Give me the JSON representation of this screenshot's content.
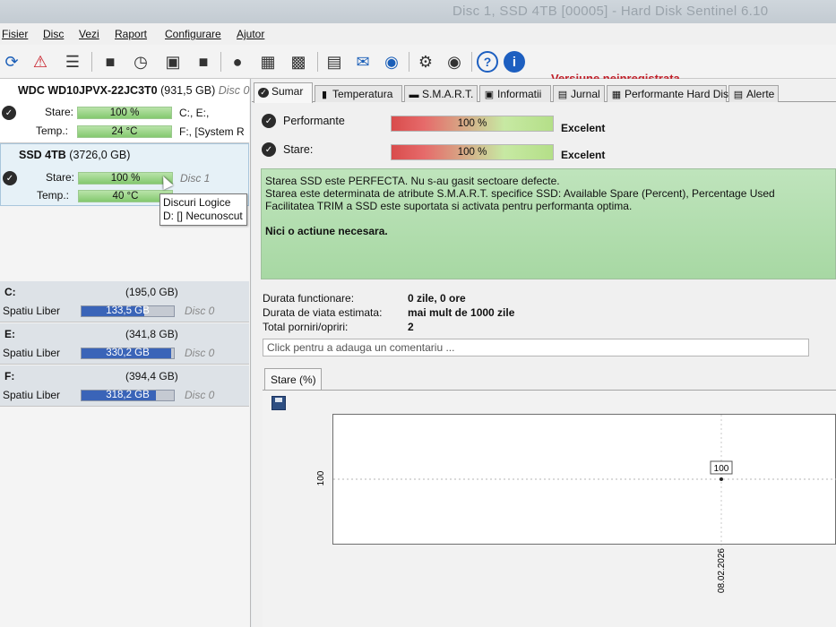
{
  "window": {
    "title": "Disc 1, SSD 4TB [00005] - Hard Disk Sentinel 6.10"
  },
  "menu": {
    "items": [
      "Fisier",
      "Disc",
      "Vezi",
      "Raport",
      "Configurare",
      "Ajutor"
    ]
  },
  "toolbar": {
    "icons": [
      "refresh-icon",
      "alert-icon",
      "disk-list-icon",
      "drive-icon",
      "drive-clock-icon",
      "drive-check-icon",
      "drive-icon",
      "drive-icon",
      "drive-stack-icon",
      "drive-stack-icon",
      "report-icon",
      "mail-icon",
      "network-icon",
      "gear-icon",
      "disk-gear-icon",
      "help-icon",
      "info-icon"
    ],
    "unregistered": "Versiune neinregistrata"
  },
  "disks": [
    {
      "name": "WDC WD10JPVX-22JC3T0",
      "size": "(931,5 GB)",
      "disc": "Disc 0",
      "stare_label": "Stare:",
      "stare": "100 %",
      "temp_label": "Temp.:",
      "temp": "24 °C",
      "letters": "C:, E:,",
      "system": "F:, [System R"
    },
    {
      "name": "SSD 4TB",
      "size": "(3726,0 GB)",
      "disc": "Disc 1",
      "stare_label": "Stare:",
      "stare": "100 %",
      "temp_label": "Temp.:",
      "temp": "40 °C"
    }
  ],
  "tooltip": {
    "line1": "Discuri Logice",
    "line2": "D: [] Necunoscut"
  },
  "partitions": [
    {
      "letter": "C:",
      "size": "(195,0 GB)",
      "free_label": "Spatiu Liber",
      "free": "133,5 GB",
      "disc": "Disc 0",
      "fill": 0.68
    },
    {
      "letter": "E:",
      "size": "(341,8 GB)",
      "free_label": "Spatiu Liber",
      "free": "330,2 GB",
      "disc": "Disc 0",
      "fill": 0.97
    },
    {
      "letter": "F:",
      "size": "(394,4 GB)",
      "free_label": "Spatiu Liber",
      "free": "318,2 GB",
      "disc": "Disc 0",
      "fill": 0.81
    }
  ],
  "tabs": [
    "Sumar",
    "Temperatura",
    "S.M.A.R.T.",
    "Informatii",
    "Jurnal",
    "Performante Hard Disk",
    "Alerte"
  ],
  "summary": {
    "perf_label": "Performante",
    "perf_value": "100 %",
    "perf_verdict": "Excelent",
    "stare_label": "Stare:",
    "stare_value": "100 %",
    "stare_verdict": "Excelent",
    "status_lines": [
      "Starea SSD este PERFECTA. Nu s-au gasit sectoare defecte.",
      "Starea este determinata de atribute S.M.A.R.T. specifice SSD: Available Spare (Percent), Percentage Used",
      "Facilitatea TRIM a SSD este suportata si activata pentru performanta optima."
    ],
    "action": "Nici o actiune necesara.",
    "durata_label": "Durata functionare:",
    "durata_value": "0 zile, 0 ore",
    "viata_label": "Durata de viata estimata:",
    "viata_value": "mai mult de 1000 zile",
    "porniri_label": "Total porniri/opriri:",
    "porniri_value": "2",
    "comment_placeholder": "Click pentru a adauga un comentariu ..."
  },
  "graph": {
    "tab": "Stare (%)"
  },
  "chart_data": {
    "type": "line",
    "x": [
      "08.02.2026"
    ],
    "series": [
      {
        "values": [
          100
        ]
      }
    ],
    "ytick": "100",
    "point_label": "100",
    "grid": true
  }
}
